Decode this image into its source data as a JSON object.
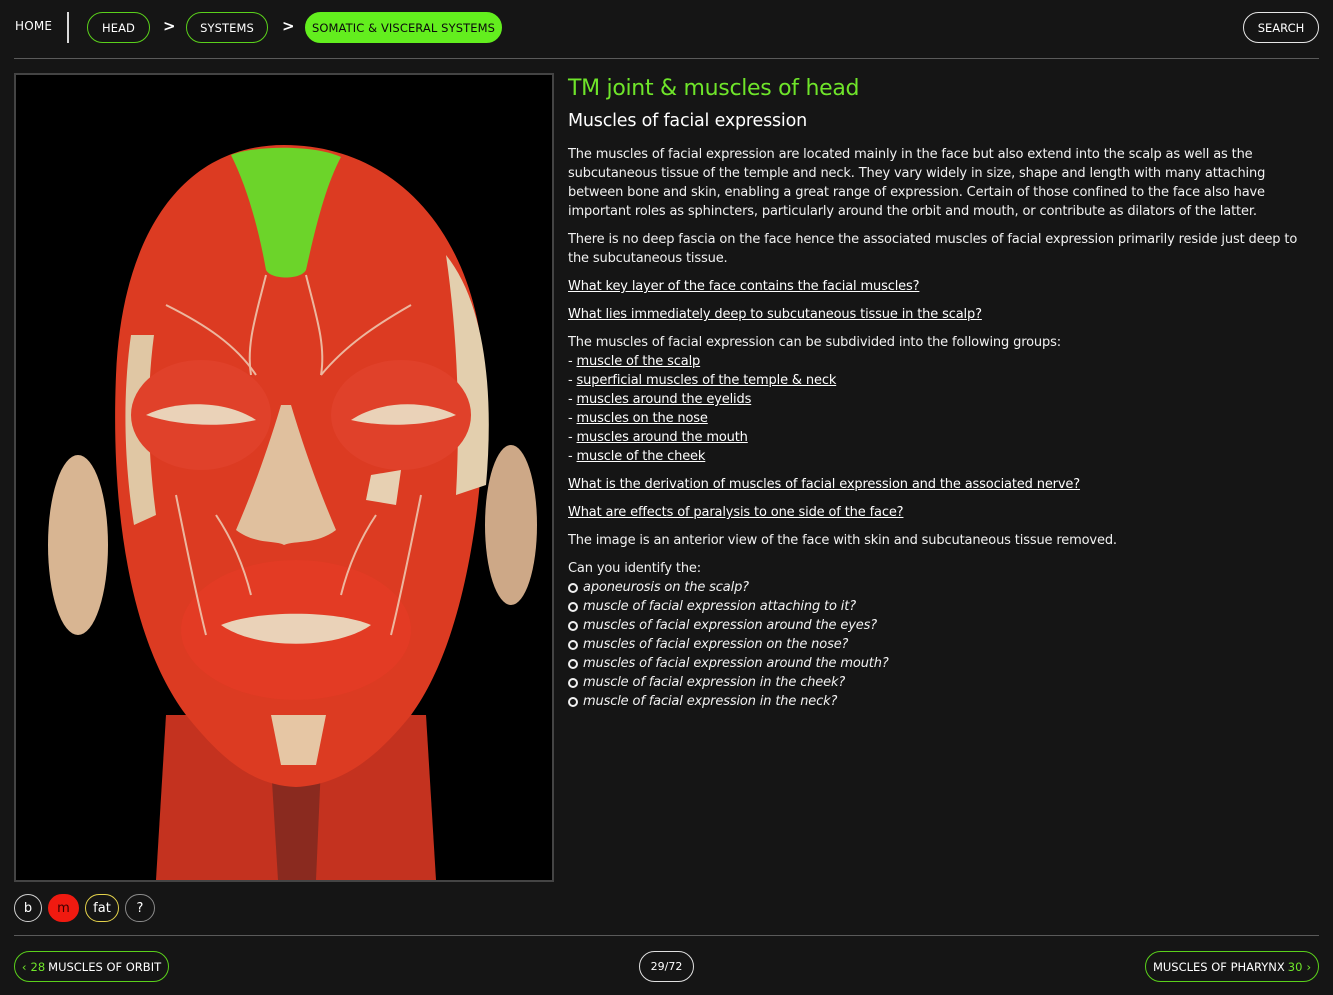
{
  "breadcrumb": {
    "home": "HOME",
    "items": [
      "HEAD",
      "SYSTEMS",
      "SOMATIC & VISCERAL SYSTEMS"
    ],
    "separator": ">"
  },
  "search_label": "SEARCH",
  "image": {
    "alt": "anterior view of the face with skin and subcutaneous tissue removed"
  },
  "content": {
    "title": "TM joint & muscles of head",
    "subtitle": "Muscles of facial expression",
    "para1": "The muscles of facial expression are located mainly in the face but also extend into the scalp as well as the subcutaneous tissue of the temple and neck. They vary widely in size, shape and length with many attaching between bone and skin, enabling a great range of expression. Certain of those confined to the face also have important roles as sphincters, particularly around the orbit and mouth, or contribute as dilators of the latter.",
    "para2": "There is no deep fascia on the face hence the associated muscles of facial expression primarily reside just deep to the subcutaneous tissue.",
    "q1": "What key layer of the face contains the facial muscles?",
    "q2": "What lies immediately deep to subcutaneous tissue in the scalp?",
    "groups_intro": "The muscles of facial expression can be subdivided into the following groups:",
    "groups": [
      "muscle of the scalp",
      "superficial muscles of the temple & neck",
      "muscles around the eyelids",
      "muscles on the nose",
      "muscles around the mouth",
      "muscle of the cheek"
    ],
    "q3": "What is the derivation of muscles of facial expression and the associated nerve?",
    "q4": "What are effects of paralysis to one side of the face?",
    "image_note": "The image is an anterior view of the face with skin and subcutaneous tissue removed.",
    "identify_intro": "Can you identify the:",
    "identify": [
      "aponeurosis on the scalp?",
      "muscle of facial expression attaching to it?",
      "muscles of facial expression around the eyes?",
      "muscles of facial expression on the nose?",
      "muscles of facial expression around the mouth?",
      "muscle of facial expression in the cheek?",
      "muscle of facial expression in the neck?"
    ]
  },
  "layers": {
    "b": "b",
    "m": "m",
    "fat": "fat",
    "help": "?"
  },
  "footer": {
    "prev_num": "28",
    "prev_label": "MUSCLES OF ORBIT",
    "page": "29/72",
    "next_label": "MUSCLES OF PHARYNX",
    "next_num": "30"
  },
  "colors": {
    "accent": "#63ee1e",
    "muscle": "#e0311d",
    "aponeurosis": "#6bd02a",
    "fat": "#e4d24b"
  }
}
